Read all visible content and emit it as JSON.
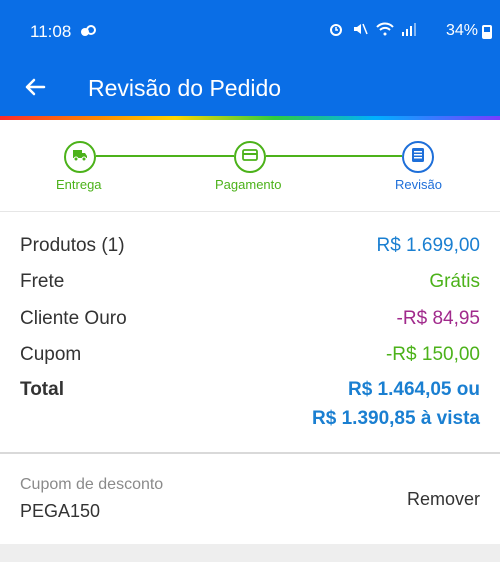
{
  "status_bar": {
    "time": "11:08",
    "battery": "34%"
  },
  "app_bar": {
    "title": "Revisão do Pedido"
  },
  "stepper": {
    "steps": [
      {
        "label": "Entrega",
        "icon": "truck-icon",
        "state": "done"
      },
      {
        "label": "Pagamento",
        "icon": "card-icon",
        "state": "done"
      },
      {
        "label": "Revisão",
        "icon": "list-icon",
        "state": "current"
      }
    ]
  },
  "summary": {
    "products": {
      "label": "Produtos (1)",
      "value": "R$ 1.699,00"
    },
    "shipping": {
      "label": "Frete",
      "value": "Grátis"
    },
    "gold_client": {
      "label": "Cliente Ouro",
      "value": "-R$ 84,95"
    },
    "coupon": {
      "label": "Cupom",
      "value": "-R$ 150,00"
    },
    "total": {
      "label": "Total",
      "value_installments": "R$ 1.464,05 ou",
      "value_cash": "R$ 1.390,85 à vista"
    }
  },
  "coupon_section": {
    "label": "Cupom de desconto",
    "code": "PEGA150",
    "remove_label": "Remover"
  },
  "colors": {
    "primary": "#0a6ee6",
    "green": "#4cb21a",
    "blue_value": "#1a7fd1",
    "purple_value": "#a12a8c"
  }
}
